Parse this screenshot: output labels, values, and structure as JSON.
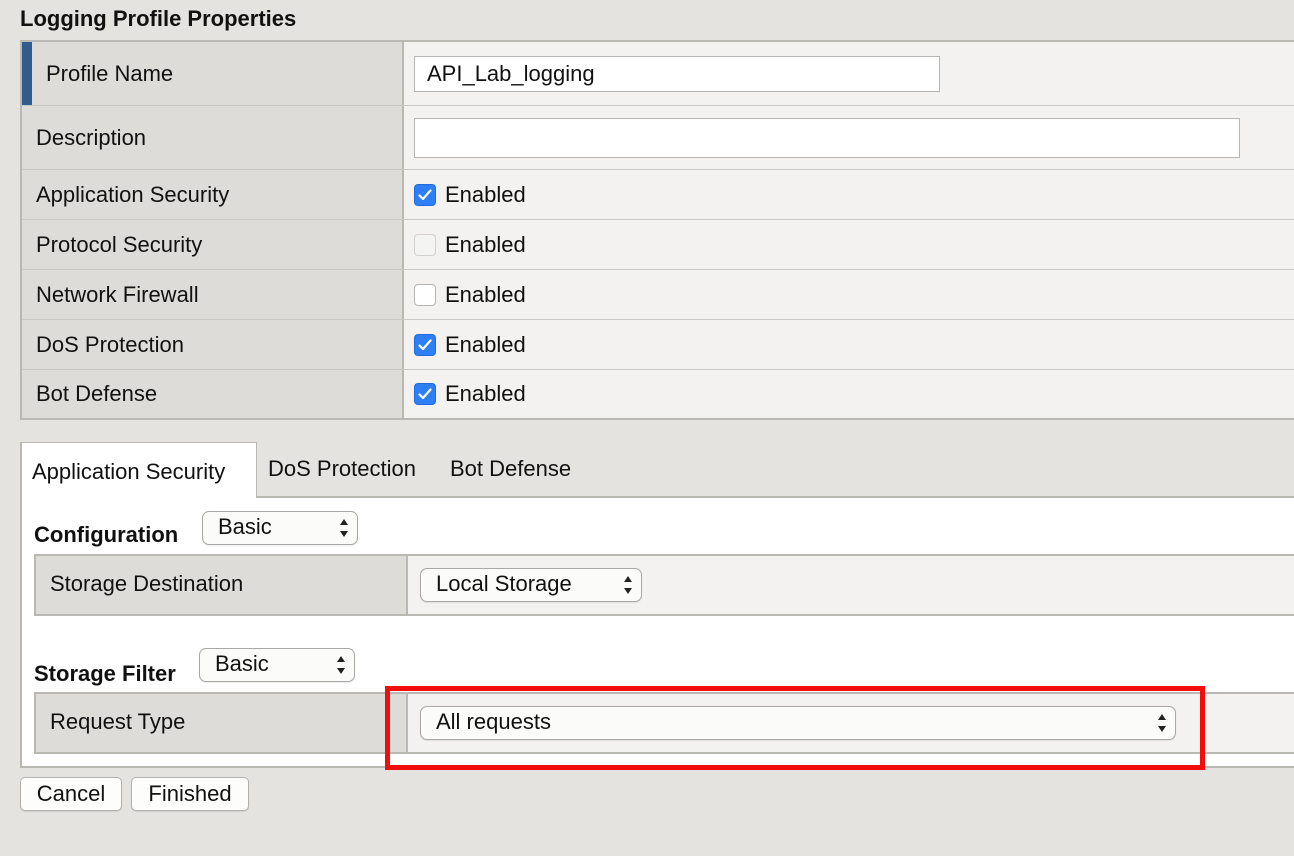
{
  "section_title": "Logging Profile Properties",
  "properties": {
    "profile_name": {
      "label": "Profile Name",
      "value": "API_Lab_logging"
    },
    "description": {
      "label": "Description",
      "value": ""
    },
    "application_security": {
      "label": "Application Security",
      "checkbox_label": "Enabled",
      "checked": true
    },
    "protocol_security": {
      "label": "Protocol Security",
      "checkbox_label": "Enabled",
      "checked": false,
      "disabled": true
    },
    "network_firewall": {
      "label": "Network Firewall",
      "checkbox_label": "Enabled",
      "checked": false
    },
    "dos_protection": {
      "label": "DoS Protection",
      "checkbox_label": "Enabled",
      "checked": true
    },
    "bot_defense": {
      "label": "Bot Defense",
      "checkbox_label": "Enabled",
      "checked": true
    }
  },
  "tabs": {
    "application_security": "Application Security",
    "dos_protection": "DoS Protection",
    "bot_defense": "Bot Defense",
    "active": "Application Security"
  },
  "configuration": {
    "label": "Configuration",
    "mode": "Basic",
    "storage_destination_label": "Storage Destination",
    "storage_destination_value": "Local Storage"
  },
  "storage_filter": {
    "label": "Storage Filter",
    "mode": "Basic",
    "request_type_label": "Request Type",
    "request_type_value": "All requests"
  },
  "buttons": {
    "cancel": "Cancel",
    "finished": "Finished"
  },
  "colors": {
    "highlight": "#f20d0d",
    "checkbox_checked": "#2e7ff5",
    "required_marker": "#2f5b8e"
  }
}
